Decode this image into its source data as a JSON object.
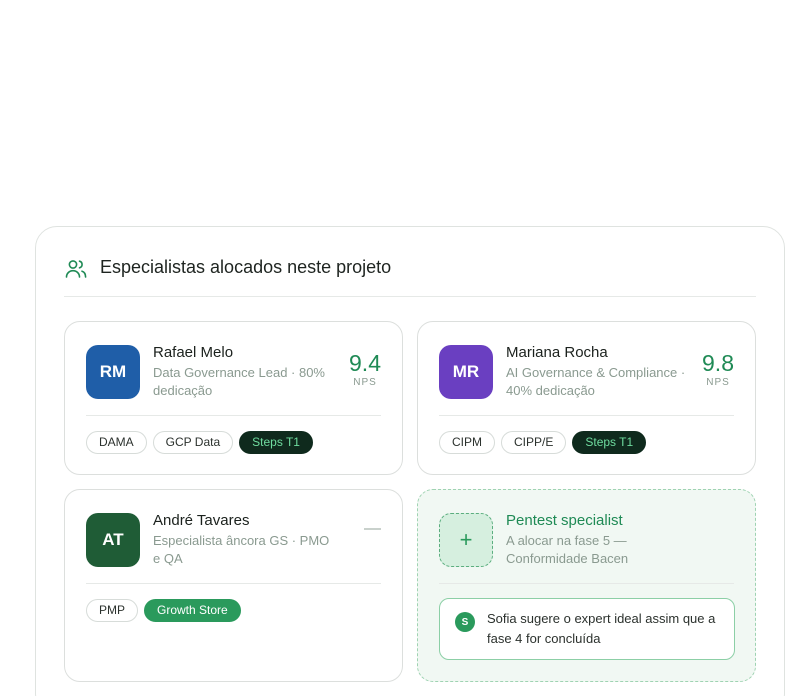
{
  "section": {
    "title": "Especialistas alocados neste projeto",
    "icon": "users-icon",
    "accent": "#1f8a55"
  },
  "specialists": [
    {
      "initials": "RM",
      "avatar_color": "#1f5ea8",
      "name": "Rafael Melo",
      "role": "Data Governance Lead · 80% dedicação",
      "score": "9.4",
      "score_label": "NPS",
      "tags": [
        "DAMA",
        "GCP Data",
        "Steps T1"
      ]
    },
    {
      "initials": "MR",
      "avatar_color": "#6a3fc1",
      "name": "Mariana Rocha",
      "role": "AI Governance & Compliance · 40% dedicação",
      "score": "9.8",
      "score_label": "NPS",
      "tags": [
        "CIPM",
        "CIPP/E",
        "Steps T1"
      ]
    },
    {
      "initials": "AT",
      "avatar_color": "#1f5c36",
      "name": "André Tavares",
      "role": "Especialista âncora GS · PMO e QA",
      "score": "—",
      "tags": [
        "PMP",
        "Growth Store"
      ]
    }
  ],
  "pending": {
    "icon": "+",
    "title": "Pentest specialist",
    "subtitle": "A alocar na fase 5 — Conformidade Bacen",
    "suggestion": {
      "avatar": "S",
      "text": "Sofia sugere o expert ideal assim que a fase 4 for concluída"
    }
  }
}
